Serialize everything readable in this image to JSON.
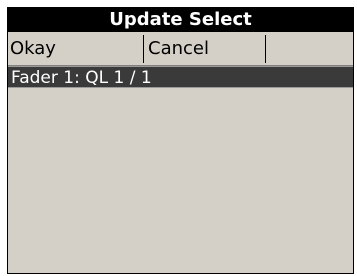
{
  "window": {
    "title": "Update Select"
  },
  "toolbar": {
    "okay_label": "Okay",
    "cancel_label": "Cancel"
  },
  "list": {
    "items": [
      {
        "label": "Fader 1: QL 1 / 1",
        "selected": true
      }
    ]
  },
  "colors": {
    "title_bg": "#000000",
    "title_fg": "#ffffff",
    "panel_bg": "#d4d0c8",
    "selected_bg": "#3a3a3a",
    "selected_fg": "#ffffff"
  }
}
